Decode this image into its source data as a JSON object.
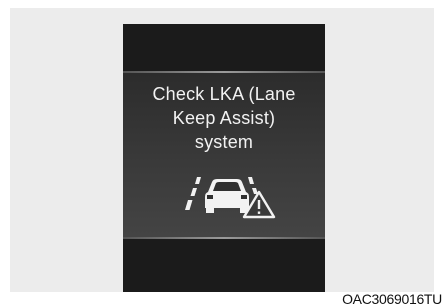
{
  "message": {
    "line1": "Check LKA (Lane",
    "line2": "Keep Assist)",
    "line3": "system"
  },
  "icons": {
    "lane_car": "lka-lane-car-icon",
    "warning": "warning-triangle-icon"
  },
  "caption": "OAC3069016TU",
  "colors": {
    "display_bg": "#1b1b1b",
    "panel_bg": "#3a3a3a",
    "text": "#f2f2f2",
    "frame_bg": "#ececec"
  }
}
